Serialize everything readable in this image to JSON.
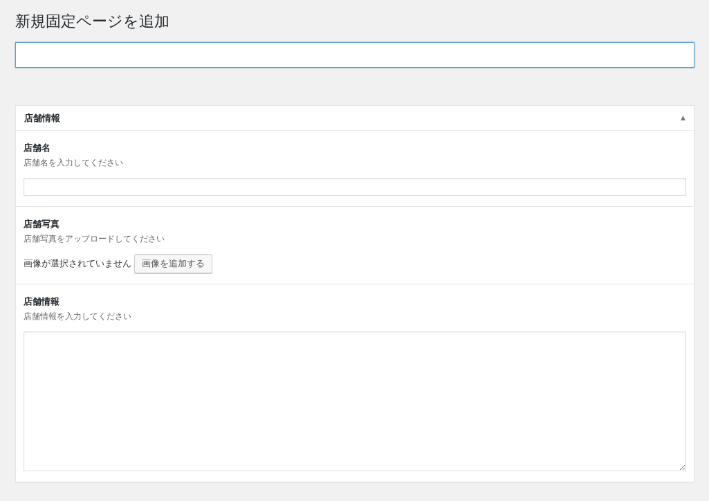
{
  "page_title": "新規固定ページを追加",
  "panel": {
    "title": "店舗情報",
    "toggle": "▲",
    "expanded": true,
    "fields": [
      {
        "kind": "text",
        "label": "店舗名",
        "description": "店舗名を入力してください"
      },
      {
        "kind": "image",
        "label": "店舗写真",
        "description": "店舗写真をアップロードしてください",
        "status": "画像が選択されていません",
        "button": "画像を追加する"
      },
      {
        "kind": "textarea",
        "label": "店舗情報",
        "description": "店舗情報を入力してください"
      }
    ]
  }
}
